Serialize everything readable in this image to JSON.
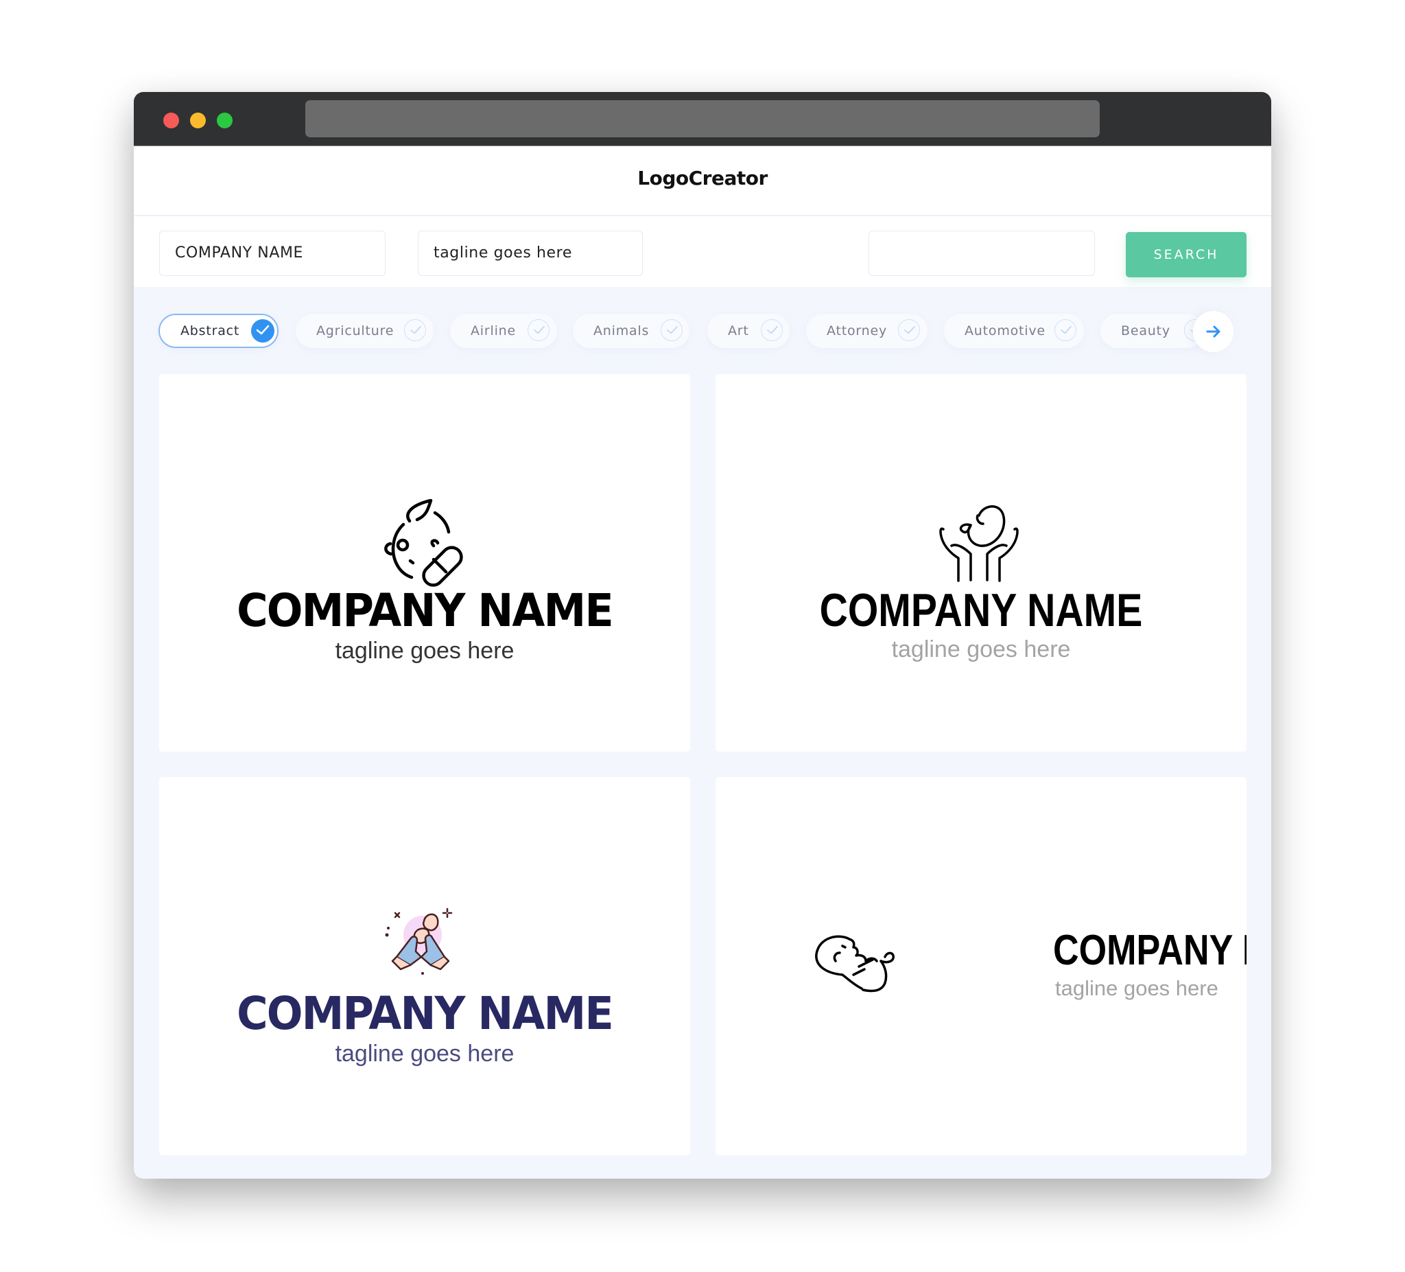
{
  "window": {
    "traffic_lights": [
      "close",
      "minimize",
      "maximize"
    ]
  },
  "header": {
    "app_title": "LogoCreator"
  },
  "search": {
    "company_name_value": "COMPANY NAME",
    "tagline_value": "tagline goes here",
    "extra_value": "",
    "search_label": "SEARCH"
  },
  "categories": {
    "items": [
      {
        "label": "Abstract",
        "selected": true
      },
      {
        "label": "Agriculture",
        "selected": false
      },
      {
        "label": "Airline",
        "selected": false
      },
      {
        "label": "Animals",
        "selected": false
      },
      {
        "label": "Art",
        "selected": false
      },
      {
        "label": "Attorney",
        "selected": false
      },
      {
        "label": "Automotive",
        "selected": false
      },
      {
        "label": "Beauty",
        "selected": false
      }
    ],
    "next_icon": "arrow-right-icon"
  },
  "logos": [
    {
      "icon": "baby-pill-icon",
      "name": "COMPANY NAME",
      "tagline": "tagline goes here",
      "name_color": "#000000",
      "tagline_color": "#333333"
    },
    {
      "icon": "hands-holding-baby-icon",
      "name": "COMPANY NAME",
      "tagline": "tagline goes here",
      "name_color": "#000000",
      "tagline_color": "#A3A3A3"
    },
    {
      "icon": "gloved-hands-newborn-icon",
      "name": "COMPANY NAME",
      "tagline": "tagline goes here",
      "name_color": "#282862",
      "tagline_color": "#4B4B80"
    },
    {
      "icon": "sleeping-baby-icon",
      "name": "COMPANY NAME",
      "tagline": "tagline goes here",
      "name_color": "#000000",
      "tagline_color": "#A3A3A3"
    }
  ],
  "colors": {
    "accent_green": "#5AC8A0",
    "selected_blue": "#3192F2",
    "titlebar": "#303133",
    "content_bg": "#F3F6FD"
  }
}
